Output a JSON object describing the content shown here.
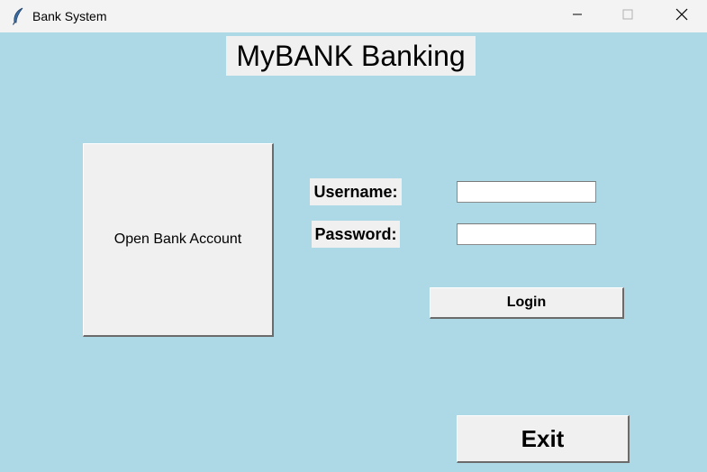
{
  "window": {
    "title": "Bank System",
    "icon": "feather-icon",
    "controls": [
      "minimize-icon",
      "maximize-icon",
      "close-icon"
    ]
  },
  "main": {
    "heading": "MyBANK Banking",
    "open_account_label": "Open Bank Account",
    "username_label": "Username:",
    "username_value": "",
    "password_label": "Password:",
    "password_value": "",
    "login_label": "Login",
    "exit_label": "Exit"
  },
  "colors": {
    "background": "#add8e6",
    "widget": "#f0f0f0",
    "titlebar": "#f3f3f3"
  }
}
